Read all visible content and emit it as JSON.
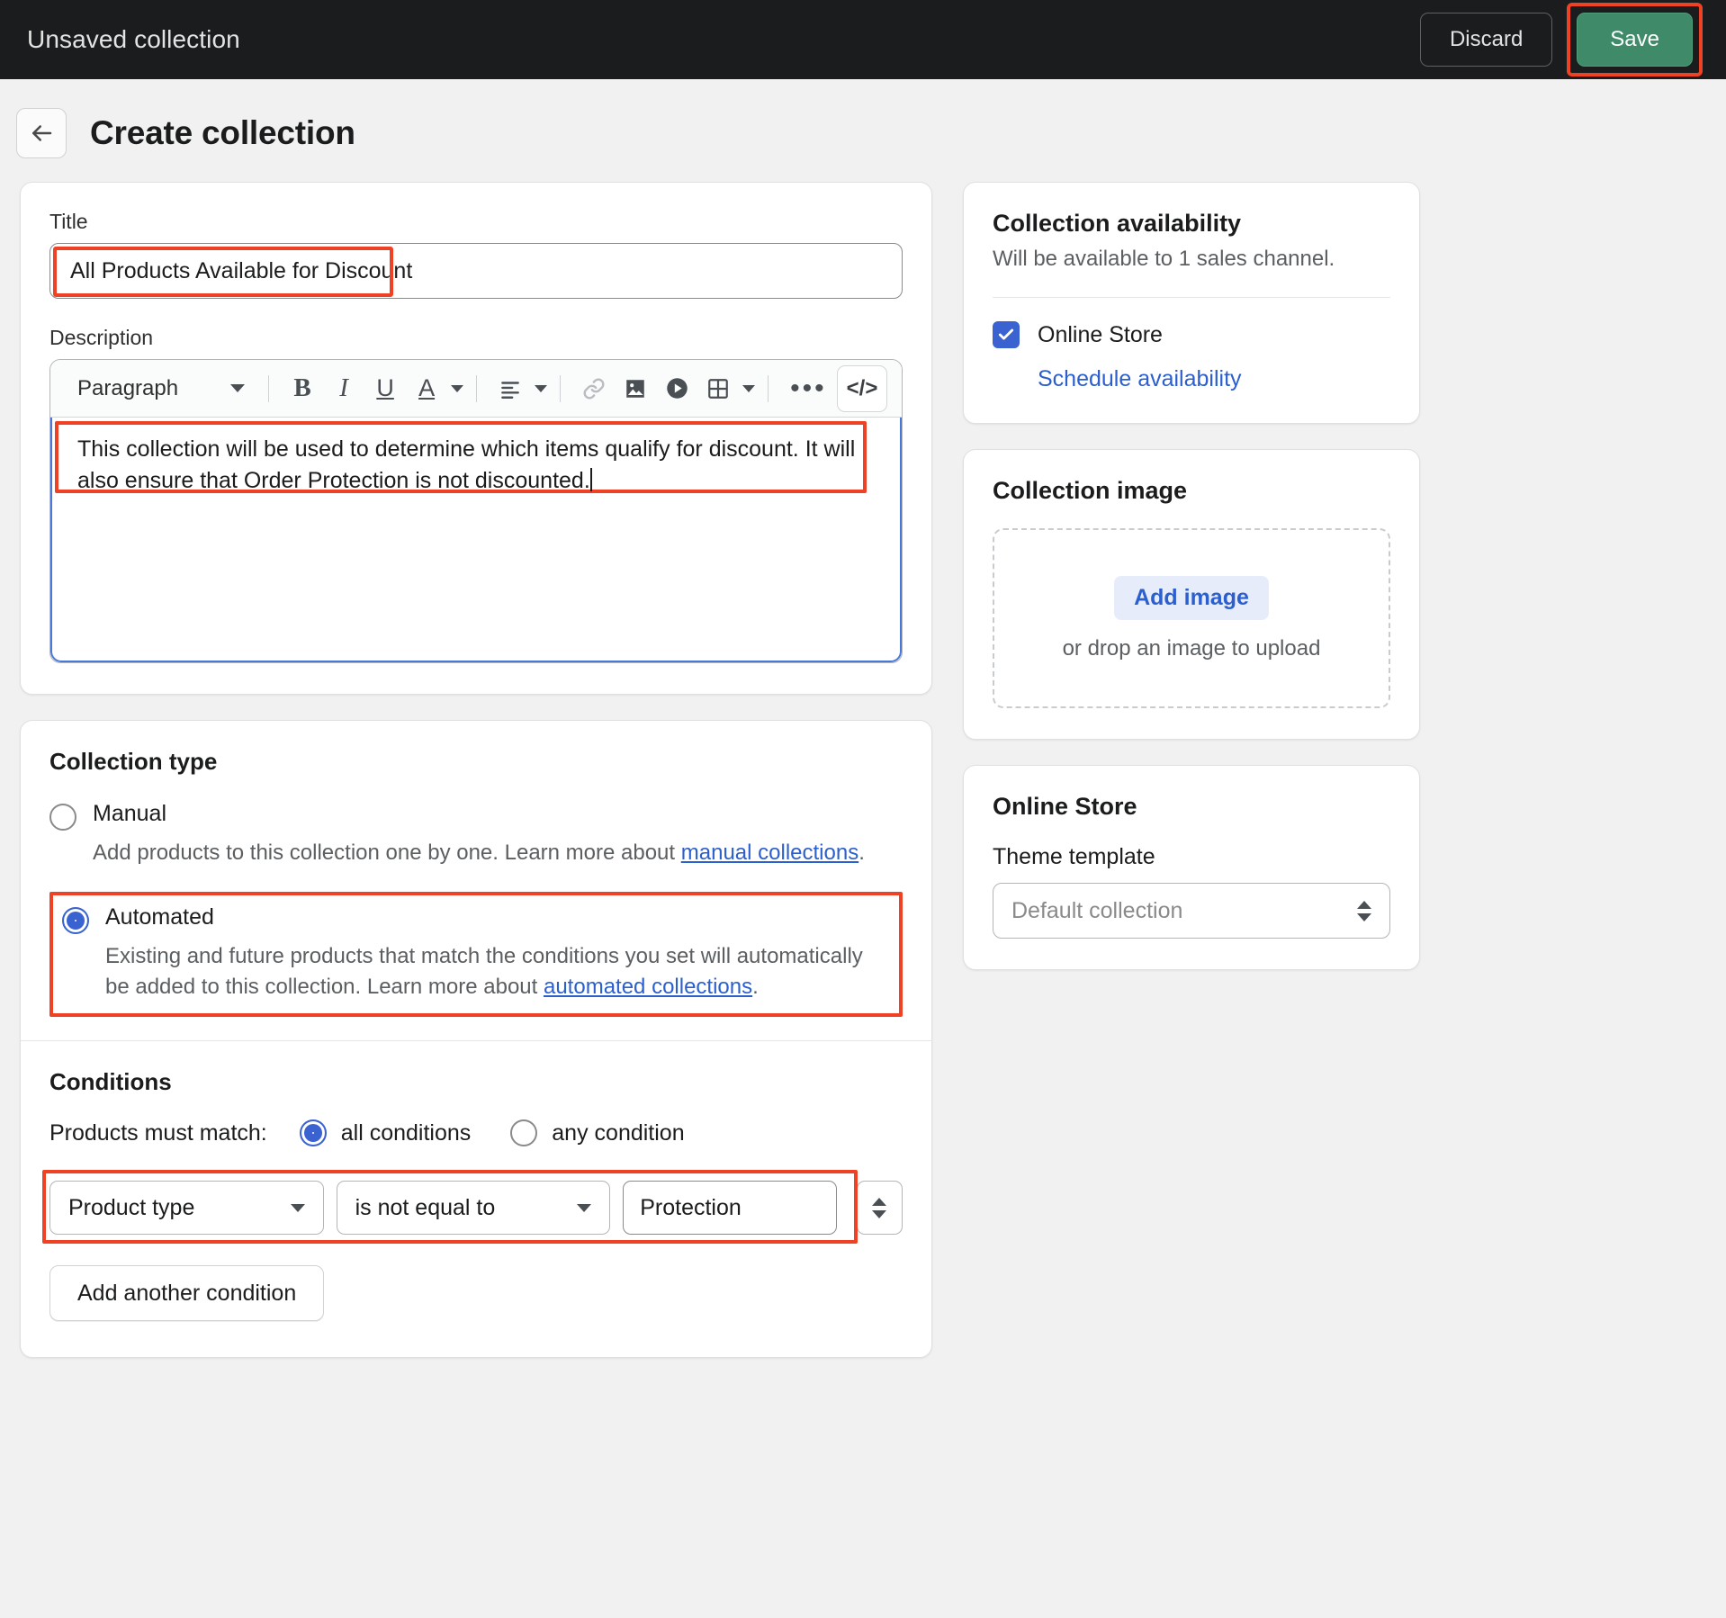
{
  "topbar": {
    "title": "Unsaved collection",
    "discard_label": "Discard",
    "save_label": "Save"
  },
  "header": {
    "back_icon": "arrow-left-icon",
    "page_title": "Create collection"
  },
  "title_field": {
    "label": "Title",
    "value": "All Products Available for Discount"
  },
  "description_field": {
    "label": "Description",
    "toolbar": {
      "block_format": "Paragraph",
      "bold": "B",
      "italic": "I",
      "underline": "U",
      "text_color": "A",
      "align": "align-left-icon",
      "link": "link-icon",
      "image": "image-icon",
      "video": "video-icon",
      "table": "table-icon",
      "more": "•••",
      "code": "</>"
    },
    "value": "This collection will be used to determine which items qualify for discount. It will also ensure that Order Protection is not discounted."
  },
  "collection_type": {
    "section_title": "Collection type",
    "manual": {
      "label": "Manual",
      "help_prefix": "Add products to this collection one by one. Learn more about ",
      "help_link": "manual collections",
      "help_suffix": ".",
      "selected": false
    },
    "automated": {
      "label": "Automated",
      "help_prefix": "Existing and future products that match the conditions you set will automatically be added to this collection. Learn more about ",
      "help_link": "automated collections",
      "help_suffix": ".",
      "selected": true
    }
  },
  "conditions": {
    "section_title": "Conditions",
    "match_label": "Products must match:",
    "match_all": "all conditions",
    "match_any": "any condition",
    "match_selected": "all conditions",
    "rows": [
      {
        "field": "Product type",
        "operator": "is not equal to",
        "value": "Protection"
      }
    ],
    "add_button": "Add another condition"
  },
  "availability": {
    "title": "Collection availability",
    "subtitle": "Will be available to 1 sales channel.",
    "channel": "Online Store",
    "channel_checked": true,
    "schedule_link": "Schedule availability"
  },
  "collection_image": {
    "title": "Collection image",
    "add_button": "Add image",
    "drop_hint": "or drop an image to upload"
  },
  "online_store": {
    "title": "Online Store",
    "theme_label": "Theme template",
    "theme_value": "Default collection"
  },
  "colors": {
    "annotation": "#ef4123",
    "save_green": "#3f8a68",
    "accent_blue": "#3a62d0",
    "link_blue": "#2c5fce",
    "topbar_dark": "#1a1c1d"
  }
}
